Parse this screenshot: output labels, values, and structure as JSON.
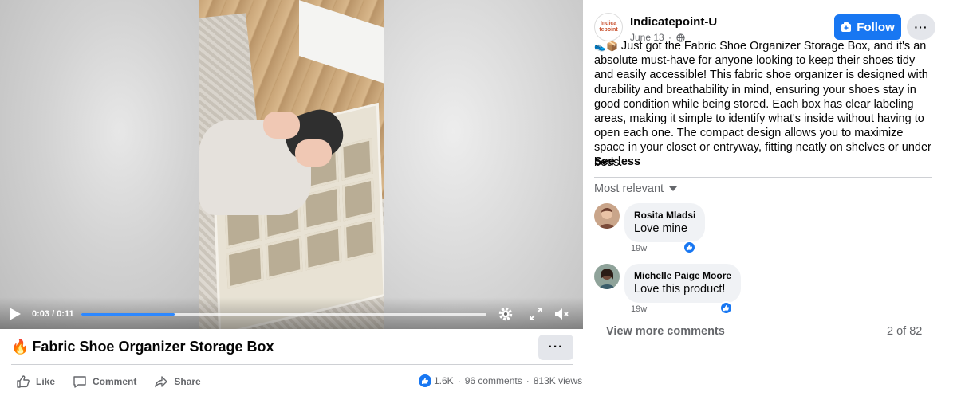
{
  "video": {
    "time": "0:03 / 0:11",
    "progress": 0.23
  },
  "post": {
    "title_emoji": "🔥",
    "title": "Fabric Shoe Organizer Storage Box",
    "more": "···",
    "actions": {
      "like": "Like",
      "comment": "Comment",
      "share": "Share"
    },
    "stats": {
      "reactions": "1.6K",
      "comments": "96 comments",
      "views": "813K views",
      "separator": "·"
    }
  },
  "page": {
    "avatar_text": "Indica tepoint",
    "name": "Indicatepoint-U",
    "date": "June 13",
    "follow_label": "Follow",
    "more": "···"
  },
  "caption": {
    "emoji": "👟📦",
    "text": "Just got the Fabric Shoe Organizer Storage Box, and it's an absolute must-have for anyone looking to keep their shoes tidy and easily accessible! This fabric shoe organizer is designed with durability and breathability in mind, ensuring your shoes stay in good condition while being stored. Each box has clear labeling areas, making it simple to identify what's inside without having to open each one. The compact design allows you to maximize space in your closet or entryway, fitting neatly on shelves or under beds.",
    "see_less": "See less"
  },
  "comments": {
    "sort_label": "Most relevant",
    "items": [
      {
        "author": "Rosita Mladsi",
        "text": "Love mine",
        "time": "19w"
      },
      {
        "author": "Michelle Paige Moore",
        "text": "Love this product!",
        "time": "19w"
      }
    ],
    "view_more": "View more comments",
    "count": "2 of 82"
  },
  "colors": {
    "brand_blue": "#1877f2",
    "progress_blue": "#2d88ff",
    "secondary_text": "#65676b",
    "bubble_bg": "#f0f2f5"
  }
}
